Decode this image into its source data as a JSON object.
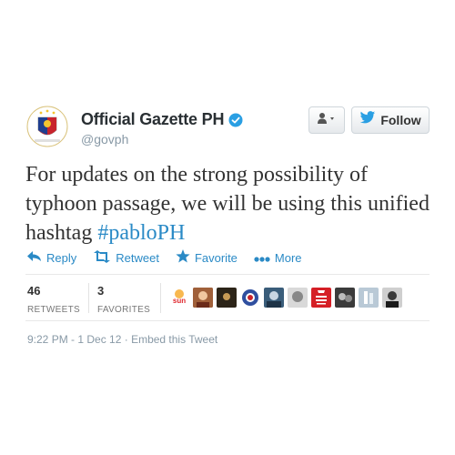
{
  "header": {
    "fullname": "Official Gazette PH",
    "handle": "@govph",
    "follow_label": "Follow",
    "avatar_icon": "philippine-seal-icon",
    "verified_icon": "verified-badge-icon"
  },
  "tweet": {
    "text_before": "For updates on the strong possibility of typhoon passage, we will be using this unified hashtag ",
    "hashtag": "#pabloPH"
  },
  "actions": [
    {
      "label": "Reply",
      "icon": "reply-icon"
    },
    {
      "label": "Retweet",
      "icon": "retweet-icon"
    },
    {
      "label": "Favorite",
      "icon": "star-icon"
    },
    {
      "label": "More",
      "icon": "more-dots-icon"
    }
  ],
  "stats": {
    "retweets_count": "46",
    "retweets_label": "RETWEETS",
    "favorites_count": "3",
    "favorites_label": "FAVORITES",
    "faces_note": "sun"
  },
  "meta": {
    "timestamp": "9:22 PM - 1 Dec 12",
    "separator": " · ",
    "embed_label": "Embed this Tweet"
  },
  "colors": {
    "link": "#2a8ac6",
    "twitter_blue": "#2a9fe3",
    "text": "#333333",
    "muted": "#8899a6"
  }
}
